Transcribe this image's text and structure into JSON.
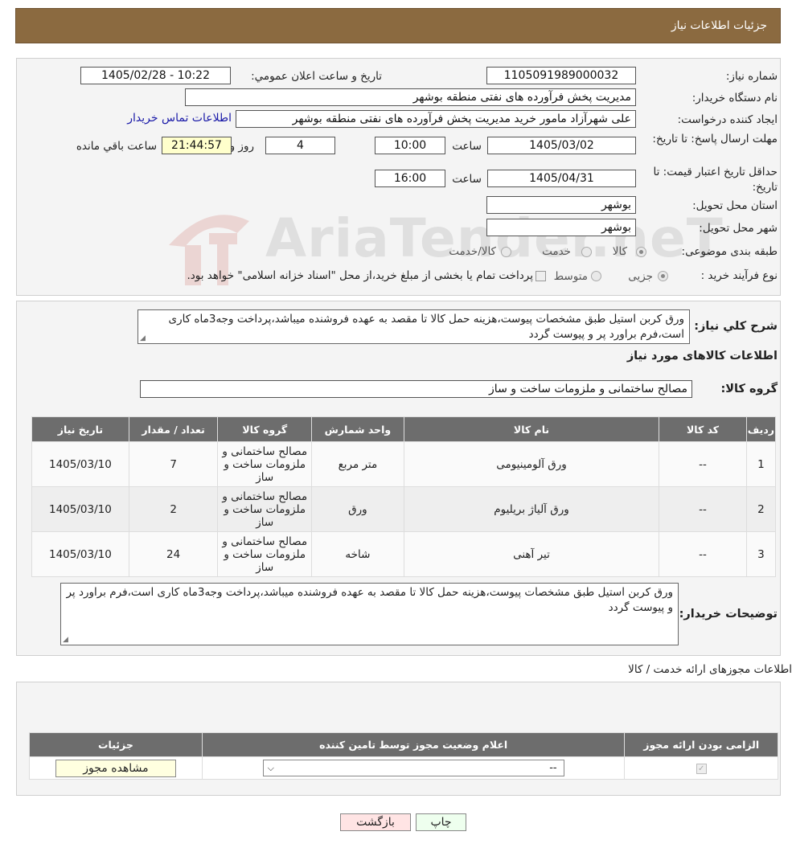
{
  "header": {
    "title": "جزئیات اطلاعات نیاز"
  },
  "watermark": {
    "text": "AriaTender.neT"
  },
  "form": {
    "need_number_label": "شماره نیاز:",
    "need_number": "1105091989000032",
    "announce_label": "تاریخ و ساعت اعلان عمومي:",
    "announce_value": "1405/02/28 - 10:22",
    "buyer_org_label": "نام دستگاه خريدار:",
    "buyer_org": "مدیریت پخش فرآورده های نفتی منطقه بوشهر",
    "creator_label": "ايجاد كننده درخواست:",
    "creator": "علی شهرآزاد مامور خرید مدیریت پخش فرآورده های نفتی منطقه بوشهر",
    "contact_link": "اطلاعات تماس خریدار",
    "deadline_label": "مهلت ارسال پاسخ: تا تاریخ:",
    "deadline_date": "1405/03/02",
    "time_label": "ساعت",
    "deadline_time": "10:00",
    "days_value": "4",
    "days_label": "روز و",
    "remaining_time": "21:44:57",
    "remaining_label": "ساعت باقي مانده",
    "validity_label": "حداقل تاریخ اعتبار قیمت: تا تاریخ:",
    "validity_date": "1405/04/31",
    "validity_time": "16:00",
    "province_label": "استان محل تحویل:",
    "province": "بوشهر",
    "city_label": "شهر محل تحویل:",
    "city": "بوشهر",
    "category_label": "طبقه بندی موضوعی:",
    "category_options": [
      "کالا",
      "خدمت",
      "کالا/خدمت"
    ],
    "process_label": "نوع فرآیند خرید :",
    "process_options": [
      "جزیی",
      "متوسط"
    ],
    "process_note": "پرداخت تمام یا بخشی از مبلغ خرید،از محل \"اسناد خزانه اسلامی\" خواهد بود."
  },
  "description": {
    "label": "شرح كلي نياز:",
    "text": "ورق کربن استیل طبق مشخصات پیوست،هزینه حمل کالا تا مقصد به عهده فروشنده میباشد،پرداخت وجه3ماه کاری است،فرم براورد پر و پیوست گردد"
  },
  "goods": {
    "section_title": "اطلاعات کالاهای مورد نیاز",
    "group_label": "گروه کالا:",
    "group_value": "مصالح ساختمانی و ملزومات ساخت و ساز",
    "columns": [
      "ردیف",
      "کد کالا",
      "نام کالا",
      "واحد شمارش",
      "گروه کالا",
      "تعداد / مقدار",
      "تاریخ نیاز"
    ],
    "rows": [
      {
        "idx": "1",
        "code": "--",
        "name": "ورق آلومینیومی",
        "unit": "متر مربع",
        "group": "مصالح ساختمانی و ملزومات ساخت و ساز",
        "qty": "7",
        "date": "1405/03/10"
      },
      {
        "idx": "2",
        "code": "--",
        "name": "ورق آلیاژ بریلیوم",
        "unit": "ورق",
        "group": "مصالح ساختمانی و ملزومات ساخت و ساز",
        "qty": "2",
        "date": "1405/03/10"
      },
      {
        "idx": "3",
        "code": "--",
        "name": "تیر آهنی",
        "unit": "شاخه",
        "group": "مصالح ساختمانی و ملزومات ساخت و ساز",
        "qty": "24",
        "date": "1405/03/10"
      }
    ]
  },
  "buyer_notes": {
    "label": "توضیحات خریدار:",
    "text": "ورق کربن استیل طبق مشخصات پیوست،هزینه حمل کالا تا مقصد به عهده فروشنده میباشد،پرداخت وجه3ماه کاری است،فرم براورد پر و پیوست گردد"
  },
  "licenses": {
    "section_title": "اطلاعات مجوزهای ارائه خدمت / کالا",
    "columns": [
      "الزامی بودن ارائه مجوز",
      "اعلام وضعیت مجوز توسط تامین کننده",
      "جزئیات"
    ],
    "status_select": "--",
    "view_button": "مشاهده مجوز"
  },
  "actions": {
    "print": "چاپ",
    "back": "بازگشت"
  },
  "colors": {
    "header_bg": "#8b6a40",
    "table_header": "#6d6d6d",
    "link": "#1a1aa8"
  }
}
